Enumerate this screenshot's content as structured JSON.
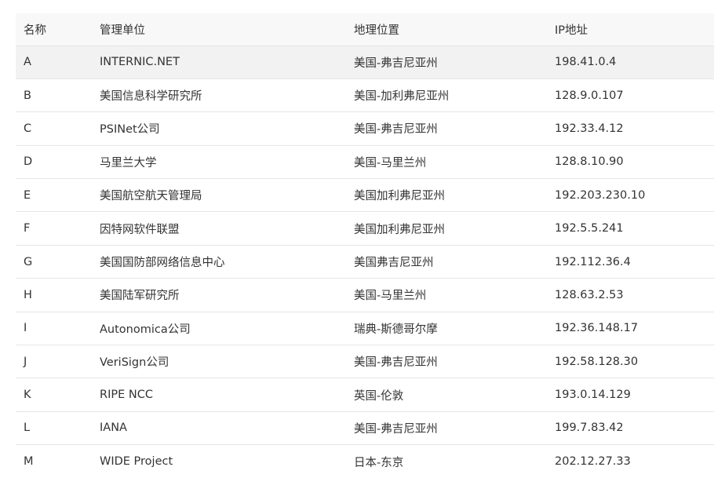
{
  "table": {
    "headers": [
      "名称",
      "管理单位",
      "地理位置",
      "IP地址"
    ],
    "rows": [
      [
        "A",
        "INTERNIC.NET",
        "美国-弗吉尼亚州",
        "198.41.0.4"
      ],
      [
        "B",
        "美国信息科学研究所",
        "美国-加利弗尼亚州",
        "128.9.0.107"
      ],
      [
        "C",
        "PSINet公司",
        "美国-弗吉尼亚州",
        "192.33.4.12"
      ],
      [
        "D",
        "马里兰大学",
        "美国-马里兰州",
        "128.8.10.90"
      ],
      [
        "E",
        "美国航空航天管理局",
        "美国加利弗尼亚州",
        "192.203.230.10"
      ],
      [
        "F",
        "因特网软件联盟",
        "美国加利弗尼亚州",
        "192.5.5.241"
      ],
      [
        "G",
        "美国国防部网络信息中心",
        "美国弗吉尼亚州",
        "192.112.36.4"
      ],
      [
        "H",
        "美国陆军研究所",
        "美国-马里兰州",
        "128.63.2.53"
      ],
      [
        "I",
        "Autonomica公司",
        "瑞典-斯德哥尔摩",
        "192.36.148.17"
      ],
      [
        "J",
        "VeriSign公司",
        "美国-弗吉尼亚州",
        "192.58.128.30"
      ],
      [
        "K",
        "RIPE NCC",
        "英国-伦敦",
        "193.0.14.129"
      ],
      [
        "L",
        "IANA",
        "美国-弗吉尼亚州",
        "199.7.83.42"
      ],
      [
        "M",
        "WIDE Project",
        "日本-东京",
        "202.12.27.33"
      ]
    ]
  }
}
